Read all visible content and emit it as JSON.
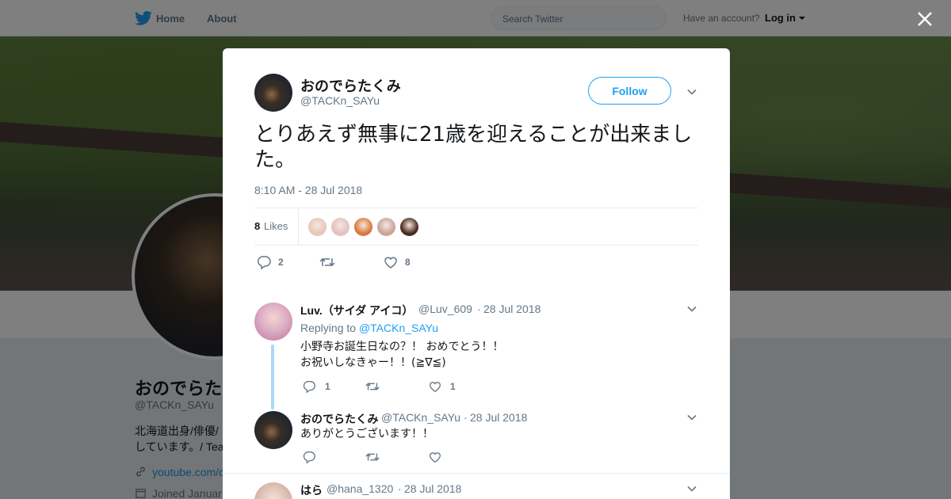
{
  "topbar": {
    "home_label": "Home",
    "about_label": "About",
    "search_placeholder": "Search Twitter",
    "account_prompt": "Have an account?",
    "login_label": "Log in"
  },
  "background_profile": {
    "name": "おのでらた",
    "handle": "@TACKn_SAYu",
    "bio_line1": "北海道出身/俳優/",
    "bio_line2": "しています。/ Tea",
    "link_text": "youtube.com/c",
    "joined_text": "Joined Januar"
  },
  "tweet": {
    "author_name": "おのでらたくみ",
    "author_handle": "@TACKn_SAYu",
    "follow_label": "Follow",
    "text": "とりあえず無事に21歳を迎えることが出来ました。",
    "timestamp": "8:10 AM - 28 Jul 2018",
    "likes_count": "8",
    "likes_label": "Likes",
    "reply_count": "2",
    "like_count_action": "8",
    "liker_colors": [
      "#e8c6b8",
      "#e3c1bf",
      "#d9793a",
      "#c9a49a",
      "#4a2a20"
    ]
  },
  "replies": [
    {
      "name": "Luv.（サイダ アイコ）",
      "handle": "@Luv_609",
      "date": "28 Jul 2018",
      "replying_prefix": "Replying to",
      "replying_to": "@TACKn_SAYu",
      "text_line1": "小野寺お誕生日なの？！ おめでとう！！",
      "text_line2": "お祝いしなきゃー！！(≧∇≦)",
      "reply_count": "1",
      "like_count": "1"
    },
    {
      "name": "おのでらたくみ",
      "handle": "@TACKn_SAYu",
      "date": "28 Jul 2018",
      "text_line1": "ありがとうございます！！"
    },
    {
      "name": "はら",
      "handle": "@hana_1320",
      "date": "28 Jul 2018"
    }
  ],
  "colors": {
    "accent": "#1da1f2",
    "overlay": "rgba(0,0,0,0.5)",
    "thread_line": "#a9d9f8"
  }
}
